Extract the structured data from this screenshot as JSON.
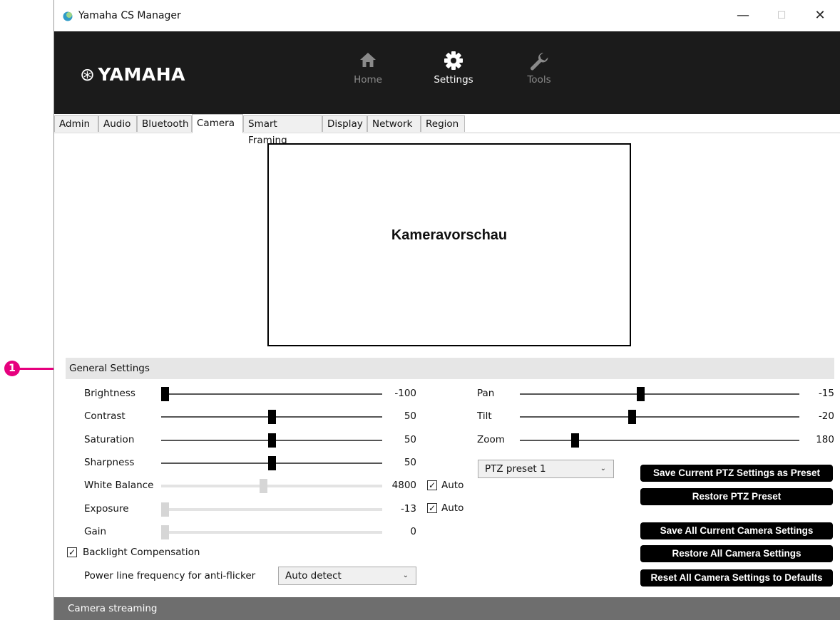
{
  "window": {
    "title": "Yamaha CS Manager",
    "controls": {
      "minimize": "—",
      "maximize": "☐",
      "close": "✕"
    }
  },
  "header": {
    "logo_mark": "⊛",
    "logo_text": "YAMAHA",
    "nav": [
      {
        "label": "Home",
        "icon": "home-icon",
        "color": "#8a8a8a"
      },
      {
        "label": "Settings",
        "icon": "gear-icon",
        "color": "#ffffff"
      },
      {
        "label": "Tools",
        "icon": "wrench-icon",
        "color": "#8a8a8a"
      }
    ]
  },
  "tabs": [
    "Admin",
    "Audio",
    "Bluetooth",
    "Camera",
    "Smart Framing",
    "Display",
    "Network",
    "Region"
  ],
  "active_tab": "Camera",
  "preview": {
    "label": "Kameravorschau"
  },
  "annotation": {
    "number": "1",
    "color": "#e6007e"
  },
  "general_settings": {
    "title": "General Settings",
    "sliders": [
      {
        "label": "Brightness",
        "value": "-100",
        "fraction": 0.0,
        "enabled": true
      },
      {
        "label": "Contrast",
        "value": "50",
        "fraction": 0.5,
        "enabled": true
      },
      {
        "label": "Saturation",
        "value": "50",
        "fraction": 0.5,
        "enabled": true
      },
      {
        "label": "Sharpness",
        "value": "50",
        "fraction": 0.5,
        "enabled": true
      },
      {
        "label": "White Balance",
        "value": "4800",
        "fraction": 0.46,
        "enabled": false,
        "auto": true
      },
      {
        "label": "Exposure",
        "value": "-13",
        "fraction": 0.0,
        "enabled": false,
        "auto": true
      },
      {
        "label": "Gain",
        "value": "0",
        "fraction": 0.0,
        "enabled": false
      }
    ],
    "auto_label": "Auto",
    "backlight_compensation": {
      "label": "Backlight Compensation",
      "checked": true
    },
    "power_line": {
      "label": "Power line frequency for anti-flicker",
      "value": "Auto detect"
    }
  },
  "ptz": {
    "sliders": [
      {
        "label": "Pan",
        "value": "-15",
        "fraction": 0.43
      },
      {
        "label": "Tilt",
        "value": "-20",
        "fraction": 0.4
      },
      {
        "label": "Zoom",
        "value": "180",
        "fraction": 0.19
      }
    ],
    "preset_dropdown": "PTZ preset 1"
  },
  "buttons": {
    "save_ptz_preset": "Save Current PTZ Settings as Preset",
    "restore_ptz_preset": "Restore PTZ Preset",
    "save_all_camera": "Save All Current Camera Settings",
    "restore_all_camera": "Restore All Camera Settings",
    "reset_all_camera": "Reset All Camera Settings to Defaults"
  },
  "footer": {
    "label": "Camera streaming"
  },
  "colors": {
    "header_bg": "#1b1b1b",
    "button_bg": "#000000",
    "footer_bg": "#6e6e6e",
    "section_bg": "#e6e6e6"
  }
}
